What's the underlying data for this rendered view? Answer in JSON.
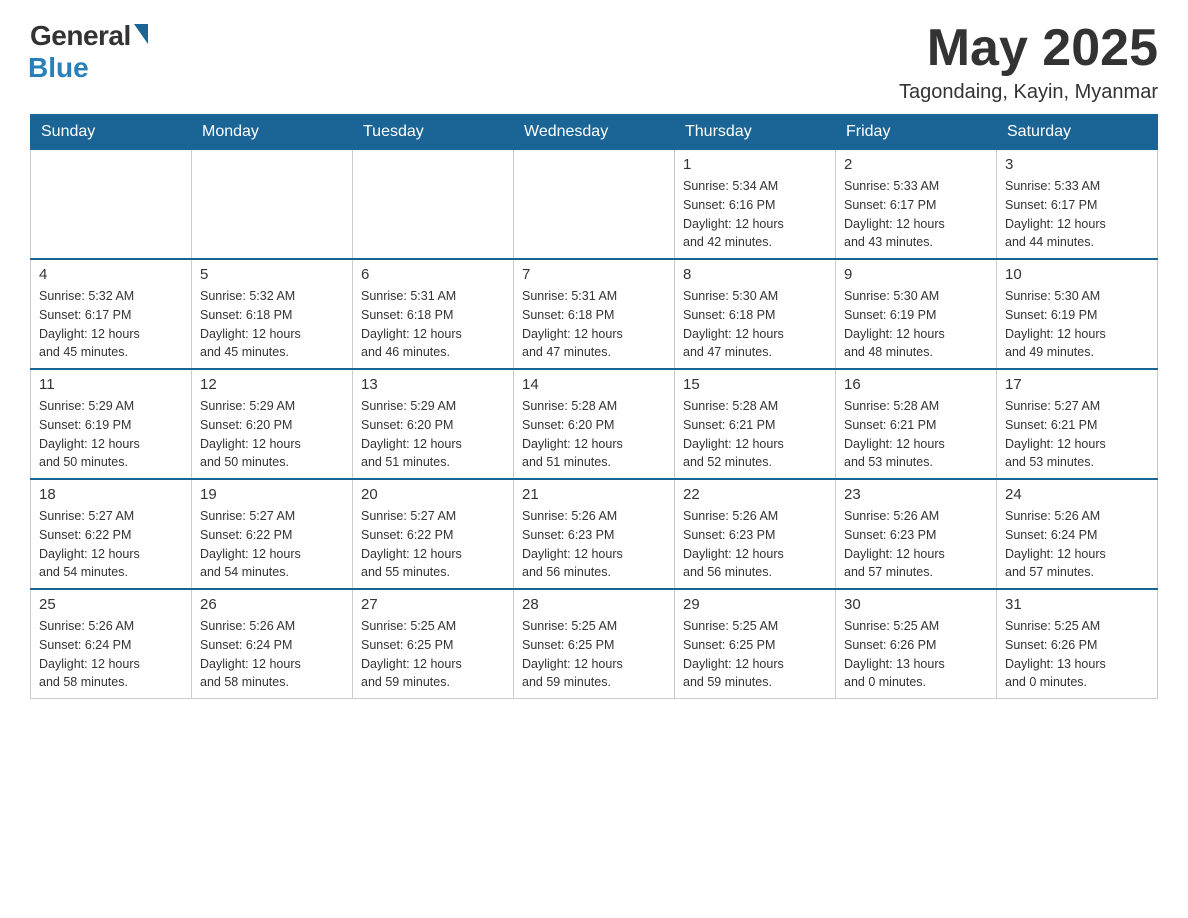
{
  "header": {
    "logo_general": "General",
    "logo_blue": "Blue",
    "month_year": "May 2025",
    "location": "Tagondaing, Kayin, Myanmar"
  },
  "days_of_week": [
    "Sunday",
    "Monday",
    "Tuesday",
    "Wednesday",
    "Thursday",
    "Friday",
    "Saturday"
  ],
  "weeks": [
    {
      "days": [
        {
          "number": "",
          "info": ""
        },
        {
          "number": "",
          "info": ""
        },
        {
          "number": "",
          "info": ""
        },
        {
          "number": "",
          "info": ""
        },
        {
          "number": "1",
          "info": "Sunrise: 5:34 AM\nSunset: 6:16 PM\nDaylight: 12 hours\nand 42 minutes."
        },
        {
          "number": "2",
          "info": "Sunrise: 5:33 AM\nSunset: 6:17 PM\nDaylight: 12 hours\nand 43 minutes."
        },
        {
          "number": "3",
          "info": "Sunrise: 5:33 AM\nSunset: 6:17 PM\nDaylight: 12 hours\nand 44 minutes."
        }
      ]
    },
    {
      "days": [
        {
          "number": "4",
          "info": "Sunrise: 5:32 AM\nSunset: 6:17 PM\nDaylight: 12 hours\nand 45 minutes."
        },
        {
          "number": "5",
          "info": "Sunrise: 5:32 AM\nSunset: 6:18 PM\nDaylight: 12 hours\nand 45 minutes."
        },
        {
          "number": "6",
          "info": "Sunrise: 5:31 AM\nSunset: 6:18 PM\nDaylight: 12 hours\nand 46 minutes."
        },
        {
          "number": "7",
          "info": "Sunrise: 5:31 AM\nSunset: 6:18 PM\nDaylight: 12 hours\nand 47 minutes."
        },
        {
          "number": "8",
          "info": "Sunrise: 5:30 AM\nSunset: 6:18 PM\nDaylight: 12 hours\nand 47 minutes."
        },
        {
          "number": "9",
          "info": "Sunrise: 5:30 AM\nSunset: 6:19 PM\nDaylight: 12 hours\nand 48 minutes."
        },
        {
          "number": "10",
          "info": "Sunrise: 5:30 AM\nSunset: 6:19 PM\nDaylight: 12 hours\nand 49 minutes."
        }
      ]
    },
    {
      "days": [
        {
          "number": "11",
          "info": "Sunrise: 5:29 AM\nSunset: 6:19 PM\nDaylight: 12 hours\nand 50 minutes."
        },
        {
          "number": "12",
          "info": "Sunrise: 5:29 AM\nSunset: 6:20 PM\nDaylight: 12 hours\nand 50 minutes."
        },
        {
          "number": "13",
          "info": "Sunrise: 5:29 AM\nSunset: 6:20 PM\nDaylight: 12 hours\nand 51 minutes."
        },
        {
          "number": "14",
          "info": "Sunrise: 5:28 AM\nSunset: 6:20 PM\nDaylight: 12 hours\nand 51 minutes."
        },
        {
          "number": "15",
          "info": "Sunrise: 5:28 AM\nSunset: 6:21 PM\nDaylight: 12 hours\nand 52 minutes."
        },
        {
          "number": "16",
          "info": "Sunrise: 5:28 AM\nSunset: 6:21 PM\nDaylight: 12 hours\nand 53 minutes."
        },
        {
          "number": "17",
          "info": "Sunrise: 5:27 AM\nSunset: 6:21 PM\nDaylight: 12 hours\nand 53 minutes."
        }
      ]
    },
    {
      "days": [
        {
          "number": "18",
          "info": "Sunrise: 5:27 AM\nSunset: 6:22 PM\nDaylight: 12 hours\nand 54 minutes."
        },
        {
          "number": "19",
          "info": "Sunrise: 5:27 AM\nSunset: 6:22 PM\nDaylight: 12 hours\nand 54 minutes."
        },
        {
          "number": "20",
          "info": "Sunrise: 5:27 AM\nSunset: 6:22 PM\nDaylight: 12 hours\nand 55 minutes."
        },
        {
          "number": "21",
          "info": "Sunrise: 5:26 AM\nSunset: 6:23 PM\nDaylight: 12 hours\nand 56 minutes."
        },
        {
          "number": "22",
          "info": "Sunrise: 5:26 AM\nSunset: 6:23 PM\nDaylight: 12 hours\nand 56 minutes."
        },
        {
          "number": "23",
          "info": "Sunrise: 5:26 AM\nSunset: 6:23 PM\nDaylight: 12 hours\nand 57 minutes."
        },
        {
          "number": "24",
          "info": "Sunrise: 5:26 AM\nSunset: 6:24 PM\nDaylight: 12 hours\nand 57 minutes."
        }
      ]
    },
    {
      "days": [
        {
          "number": "25",
          "info": "Sunrise: 5:26 AM\nSunset: 6:24 PM\nDaylight: 12 hours\nand 58 minutes."
        },
        {
          "number": "26",
          "info": "Sunrise: 5:26 AM\nSunset: 6:24 PM\nDaylight: 12 hours\nand 58 minutes."
        },
        {
          "number": "27",
          "info": "Sunrise: 5:25 AM\nSunset: 6:25 PM\nDaylight: 12 hours\nand 59 minutes."
        },
        {
          "number": "28",
          "info": "Sunrise: 5:25 AM\nSunset: 6:25 PM\nDaylight: 12 hours\nand 59 minutes."
        },
        {
          "number": "29",
          "info": "Sunrise: 5:25 AM\nSunset: 6:25 PM\nDaylight: 12 hours\nand 59 minutes."
        },
        {
          "number": "30",
          "info": "Sunrise: 5:25 AM\nSunset: 6:26 PM\nDaylight: 13 hours\nand 0 minutes."
        },
        {
          "number": "31",
          "info": "Sunrise: 5:25 AM\nSunset: 6:26 PM\nDaylight: 13 hours\nand 0 minutes."
        }
      ]
    }
  ]
}
